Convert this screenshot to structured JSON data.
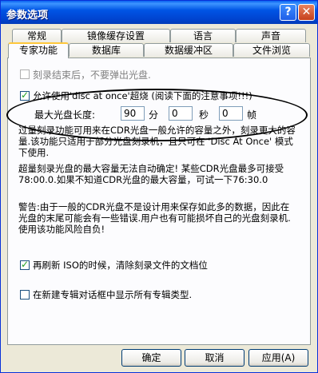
{
  "window": {
    "title": "参数选项"
  },
  "title_buttons": {
    "help": "?",
    "close": "✕"
  },
  "tabs_back": [
    "常规",
    "镜像缓存设置",
    "语言",
    "声音"
  ],
  "tabs_front": [
    "专家功能",
    "数据库",
    "数据缓冲区",
    "文件浏览"
  ],
  "active_tab": "专家功能",
  "options": {
    "eject_after_burn": {
      "label": "刻录结束后，不要弹出光盘.",
      "checked": false,
      "enabled": false
    },
    "allow_dao_overburn": {
      "label": "允许使用'disc at once'超烧 (阅读下面的注意事项!!!)",
      "checked": true
    },
    "refresh_iso": {
      "label": "再刷新 ISO的时候，清除刻录文件的文档位",
      "checked": true
    },
    "show_all_projects": {
      "label": "在新建专辑对话框中显示所有专辑类型.",
      "checked": false
    }
  },
  "max_length": {
    "label": "最大光盘长度:",
    "minutes": "90",
    "minutes_unit": "分",
    "seconds": "0",
    "seconds_unit": "秒",
    "frames": "0",
    "frames_unit": "帧"
  },
  "notes": {
    "p1": "过量刻录功能可用来在CDR光盘一般允许的容量之外，刻录更大的容量.该功能只适用于部分光盘刻录机，且只可在 'Disc At Once' 模式下使用.",
    "p2": "超量刻录光盘的最大容量无法自动确定! 某些CDR光盘最多可接受78:00.0.如果不知道CDR光盘的最大容量，可试一下76:30.0",
    "p3": "警告:由于一般的CDR光盘不是设计用来保存如此多的数据，因此在光盘的末尾可能会有一些错误.用户也有可能损坏自己的光盘刻录机.使用该功能风险自负!"
  },
  "buttons": {
    "ok": "确定",
    "cancel": "取消",
    "apply": "应用(A)"
  }
}
